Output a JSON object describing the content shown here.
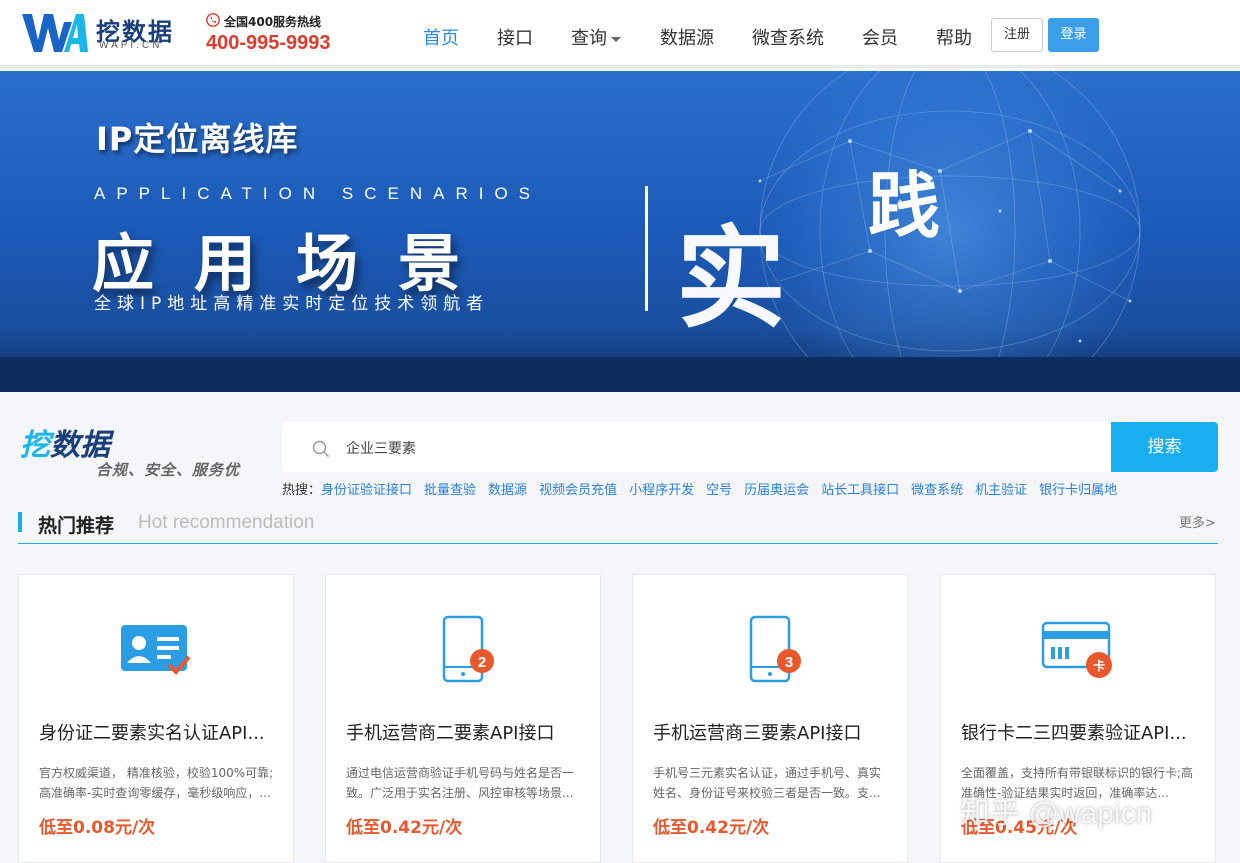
{
  "header": {
    "logo_name": "挖数据",
    "logo_sub": "WAPI.CN",
    "hotline_label": "全国400服务热线",
    "hotline_number": "400-995-9993",
    "nav": [
      "首页",
      "接口",
      "查询",
      "数据源",
      "微查系统",
      "会员",
      "帮助"
    ],
    "active_nav": "首页",
    "register": "注册",
    "login": "登录"
  },
  "banner": {
    "title": "IP定位离线库",
    "en": "APPLICATION SCENARIOS",
    "big": "应用场景",
    "sub": "全球IP地址高精准实时定位技术领航者",
    "shi": "实",
    "jian": "践"
  },
  "search": {
    "brand_a": "挖",
    "brand_b": "数据",
    "slogan": "合规、安全、服务优",
    "value": "企业三要素",
    "button": "搜索",
    "hot_label": "热搜：",
    "hot_links": [
      "身份证验证接口",
      "批量查验",
      "数据源",
      "视频会员充值",
      "小程序开发",
      "空号",
      "历届奥运会",
      "站长工具接口",
      "微查系统",
      "机主验证",
      "银行卡归属地"
    ]
  },
  "recommend": {
    "title": "热门推荐",
    "en": "Hot recommendation",
    "more": "更多>"
  },
  "cards": [
    {
      "icon": "id-card-icon",
      "title": "身份证二要素实名认证API...",
      "desc": "官方权威渠道， 精准核验，校验100%可靠;高准确率-实时查询零缓存，毫秒级响应，...",
      "price": "低至0.08元/次"
    },
    {
      "icon": "phone-2-icon",
      "title": "手机运营商二要素API接口",
      "desc": "通过电信运营商验证手机号码与姓名是否一致。广泛用于实名注册、风控审核等场景...",
      "price": "低至0.42元/次"
    },
    {
      "icon": "phone-3-icon",
      "title": "手机运营商三要素API接口",
      "desc": "手机号三元素实名认证，通过手机号、真实姓名、身份证号来校验三者是否一致。支...",
      "price": "低至0.42元/次"
    },
    {
      "icon": "bank-card-icon",
      "title": "银行卡二三四要素验证API...",
      "desc": "全面覆盖，支持所有带银联标识的银行卡;高准确性-验证结果实时返回，准确率达...",
      "price": "低至0.45元/次"
    }
  ],
  "watermark": "知乎 @wapicn",
  "colors": {
    "accent": "#18aef0",
    "price": "#e8582c",
    "brand": "#1a3f7a",
    "hotline": "#e03a2f"
  }
}
